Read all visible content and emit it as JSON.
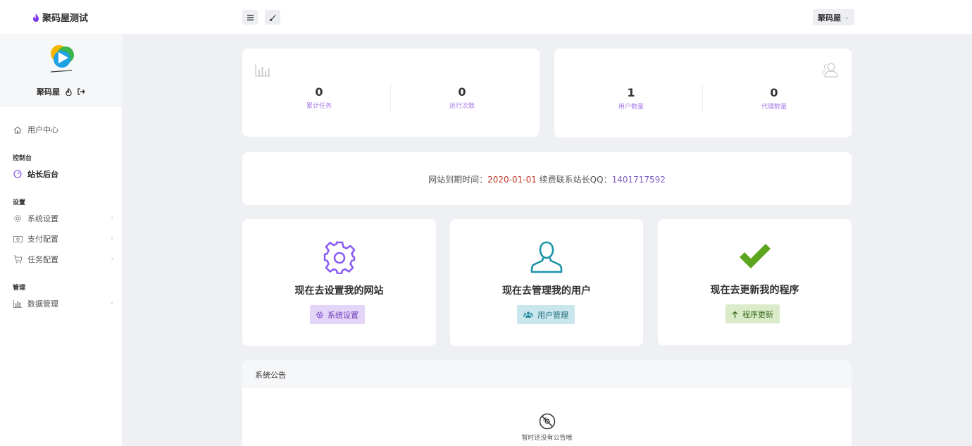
{
  "header": {
    "site_title": "聚码屋测试",
    "user_name": "聚码屋",
    "caret": "⌄"
  },
  "sidebar": {
    "profile_name": "聚码屋",
    "items": [
      {
        "label": "用户中心",
        "icon": "home-icon"
      },
      {
        "section": "控制台"
      },
      {
        "label": "站长后台",
        "icon": "dashboard-icon"
      },
      {
        "section": "设置"
      },
      {
        "label": "系统设置",
        "icon": "gear-icon"
      },
      {
        "label": "支付配置",
        "icon": "money-icon"
      },
      {
        "label": "任务配置",
        "icon": "cart-icon"
      },
      {
        "section": "管理"
      },
      {
        "label": "数据管理",
        "icon": "bar-chart-icon"
      }
    ],
    "chevron": "‹"
  },
  "stats_left": {
    "total_tasks": {
      "value": "0",
      "label": "累计任务"
    },
    "run_count": {
      "value": "0",
      "label": "运行次数"
    }
  },
  "stats_right": {
    "user_count": {
      "value": "1",
      "label": "用户数量"
    },
    "agent_count": {
      "value": "0",
      "label": "代理数量"
    }
  },
  "notice": {
    "prefix": "网站到期时间：",
    "date": "2020-01-01",
    "middle": " 续费联系站长QQ：",
    "qq": "1401717592"
  },
  "features": [
    {
      "title": "现在去设置我的网站",
      "button": "系统设置",
      "icon": "gear-icon",
      "color": "#8b5cf6",
      "btn_bg": "#e4d4f7",
      "btn_fg": "#6b3fb8"
    },
    {
      "title": "现在去管理我的用户",
      "button": "用户管理",
      "icon": "user-icon",
      "color": "#1a93a8",
      "btn_bg": "#c9e6ec",
      "btn_fg": "#1d6a78"
    },
    {
      "title": "现在去更新我的程序",
      "button": "程序更新",
      "icon": "check-icon",
      "color": "#5ba51f",
      "btn_bg": "#d9ebc9",
      "btn_fg": "#3e6b1c"
    }
  ],
  "announcement": {
    "title": "系统公告",
    "empty_text": "暂时还没有公告哦"
  }
}
